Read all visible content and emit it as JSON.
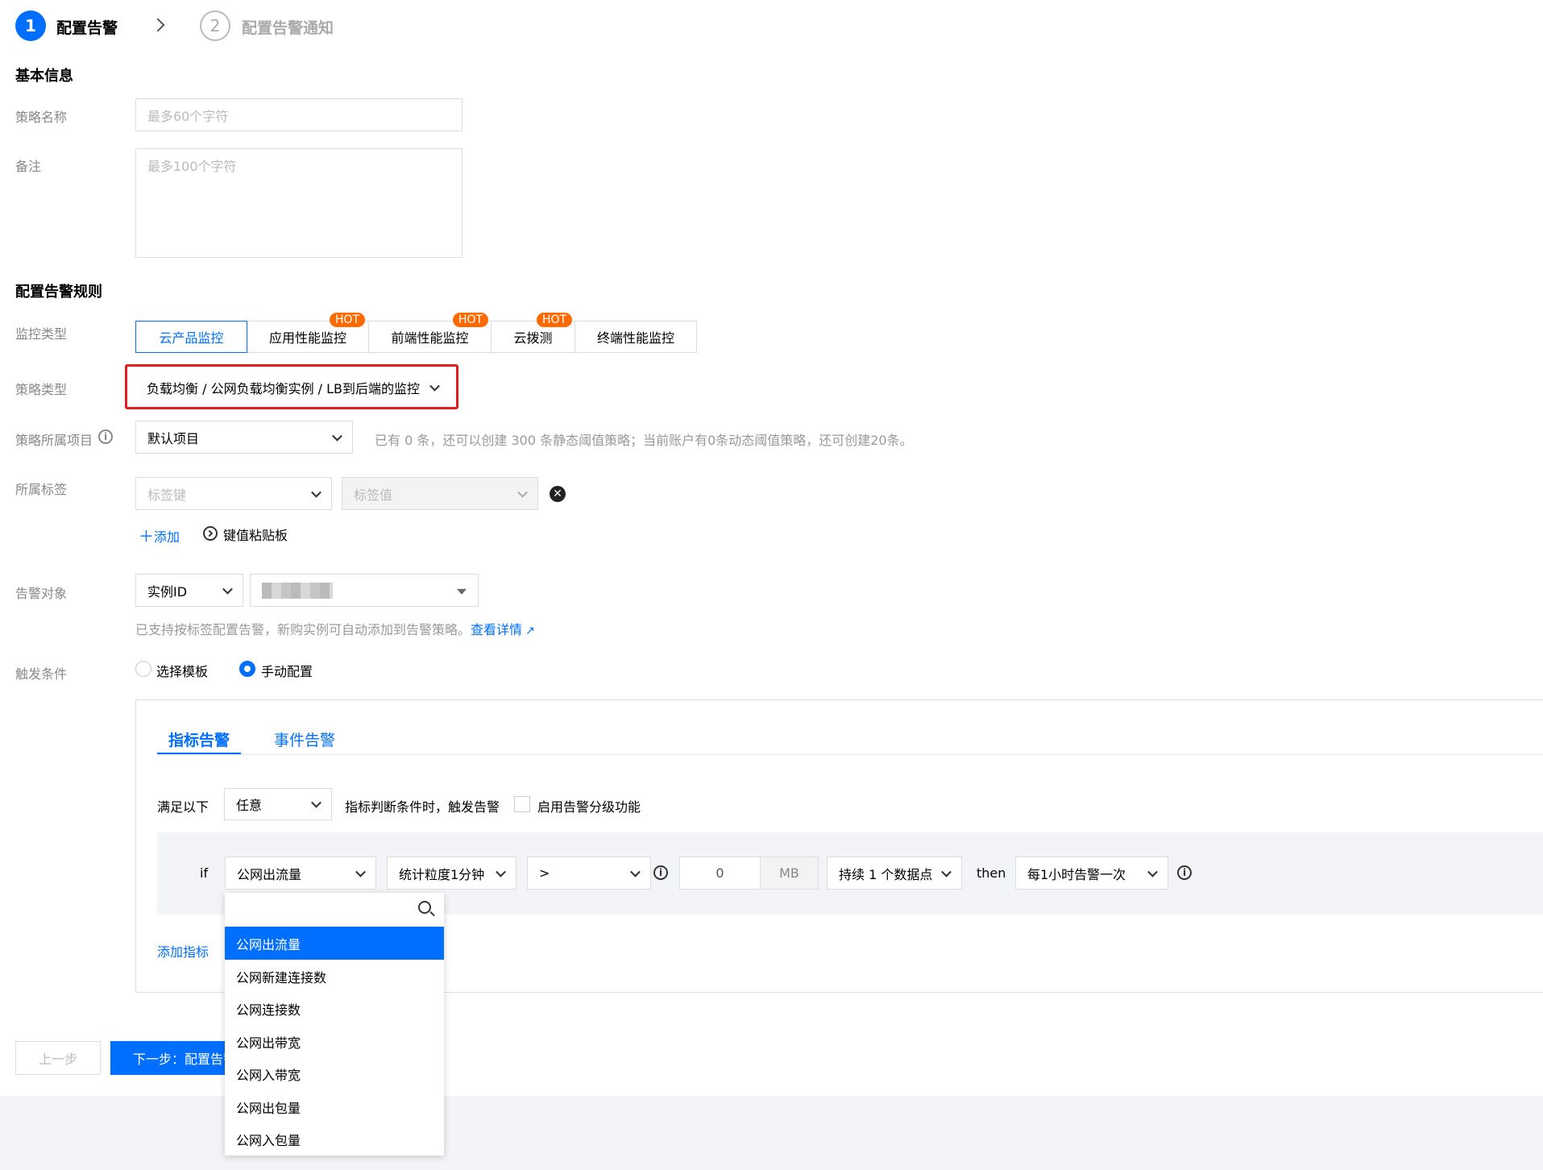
{
  "steps": [
    {
      "number": "1",
      "label": "配置告警"
    },
    {
      "number": "2",
      "label": "配置告警通知"
    }
  ],
  "basic_info": {
    "title": "基本信息",
    "policy_name_label": "策略名称",
    "policy_name_placeholder": "最多60个字符",
    "remark_label": "备注",
    "remark_placeholder": "最多100个字符"
  },
  "rules": {
    "title": "配置告警规则",
    "monitor_type_label": "监控类型",
    "monitor_types": [
      {
        "label": "云产品监控",
        "hot": ""
      },
      {
        "label": "应用性能监控",
        "hot": "HOT"
      },
      {
        "label": "前端性能监控",
        "hot": "HOT"
      },
      {
        "label": "云拨测",
        "hot": "HOT"
      },
      {
        "label": "终端性能监控",
        "hot": ""
      }
    ],
    "policy_type_label": "策略类型",
    "policy_type_value": "负载均衡 / 公网负载均衡实例 / LB到后端的监控",
    "project_label": "策略所属项目",
    "project_value": "默认项目",
    "project_hint": "已有 0 条，还可以创建 300 条静态阈值策略；当前账户有0条动态阈值策略，还可创建20条。",
    "tag_label": "所属标签",
    "tag_key_placeholder": "标签键",
    "tag_value_placeholder": "标签值",
    "add_label": "添加",
    "clipboard_label": "键值粘贴板",
    "alarm_object_label": "告警对象",
    "instance_type": "实例ID",
    "object_hint": "已支持按标签配置告警，新购实例可自动添加到告警策略。",
    "details_link": "查看详情",
    "trigger_label": "触发条件",
    "trigger_options": [
      "选择模板",
      "手动配置"
    ]
  },
  "panel": {
    "tabs": [
      "指标告警",
      "事件告警"
    ],
    "satisfy_label": "满足以下",
    "satisfy_value": "任意",
    "satisfy_suffix": "指标判断条件时，触发告警",
    "grading_label": "启用告警分级功能",
    "if_label": "if",
    "metric_value": "公网出流量",
    "granularity_value": "统计粒度1分钟",
    "operator_value": ">",
    "threshold_value": "0",
    "unit": "MB",
    "duration_value": "持续 1 个数据点",
    "then_label": "then",
    "frequency_value": "每1小时告警一次",
    "add_metric": "添加指标"
  },
  "dropdown": {
    "items": [
      "公网出流量",
      "公网新建连接数",
      "公网连接数",
      "公网出带宽",
      "公网入带宽",
      "公网出包量",
      "公网入包量"
    ]
  },
  "footer": {
    "prev_label": "上一步",
    "next_label": "下一步：配置告警通知"
  },
  "colors": {
    "primary": "#006eff",
    "hot": "#ff6a00",
    "highlight": "#e02020"
  }
}
